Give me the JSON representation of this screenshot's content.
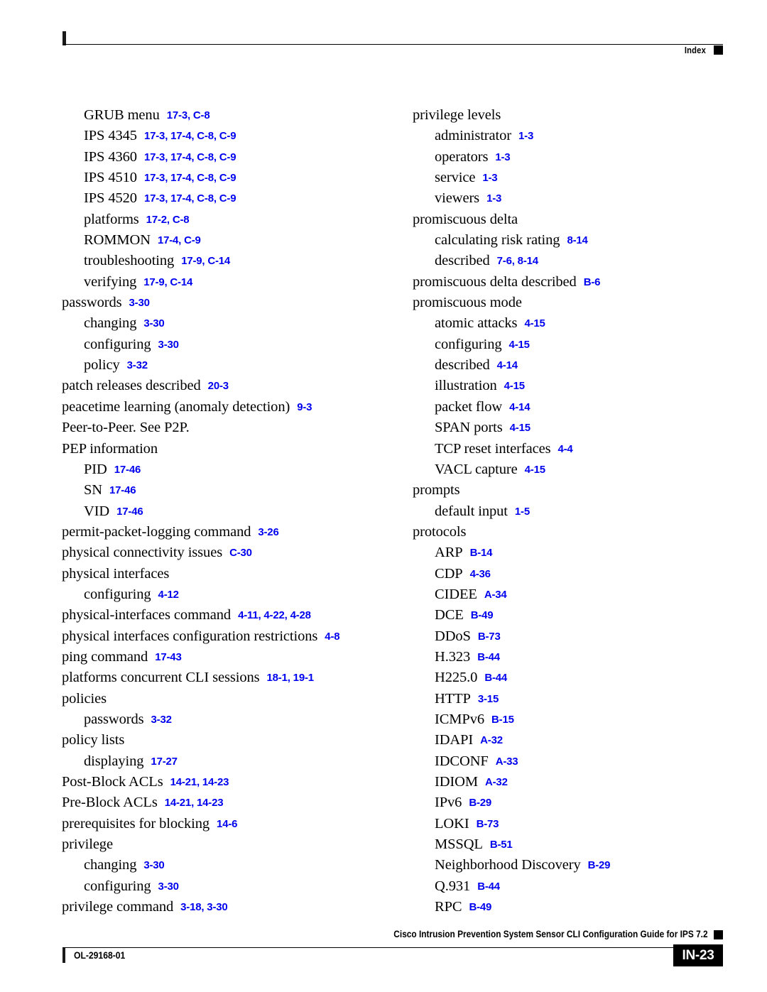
{
  "header": {
    "label": "Index",
    "marker_icon": "black-square-icon"
  },
  "footer": {
    "guide_title": "Cisco Intrusion Prevention System Sensor CLI Configuration Guide for IPS 7.2",
    "doc_id": "OL-29168-01",
    "page_number": "IN-23",
    "marker_icon": "black-square-icon"
  },
  "index": {
    "columns": [
      {
        "name": "left-column",
        "entries": [
          {
            "level": 1,
            "term": "GRUB menu",
            "locators": "17-3, C-8"
          },
          {
            "level": 1,
            "term": "IPS 4345",
            "locators": "17-3, 17-4, C-8, C-9"
          },
          {
            "level": 1,
            "term": "IPS 4360",
            "locators": "17-3, 17-4, C-8, C-9"
          },
          {
            "level": 1,
            "term": "IPS 4510",
            "locators": "17-3, 17-4, C-8, C-9"
          },
          {
            "level": 1,
            "term": "IPS 4520",
            "locators": "17-3, 17-4, C-8, C-9"
          },
          {
            "level": 1,
            "term": "platforms",
            "locators": "17-2, C-8"
          },
          {
            "level": 1,
            "term": "ROMMON",
            "locators": "17-4, C-9"
          },
          {
            "level": 1,
            "term": "troubleshooting",
            "locators": "17-9, C-14"
          },
          {
            "level": 1,
            "term": "verifying",
            "locators": "17-9, C-14"
          },
          {
            "level": 0,
            "term": "passwords",
            "locators": "3-30"
          },
          {
            "level": 1,
            "term": "changing",
            "locators": "3-30"
          },
          {
            "level": 1,
            "term": "configuring",
            "locators": "3-30"
          },
          {
            "level": 1,
            "term": "policy",
            "locators": "3-32"
          },
          {
            "level": 0,
            "term": "patch releases described",
            "locators": "20-3"
          },
          {
            "level": 0,
            "term": "peacetime learning (anomaly detection)",
            "locators": "9-3"
          },
          {
            "level": 0,
            "term": "Peer-to-Peer. See P2P.",
            "locators": ""
          },
          {
            "level": 0,
            "term": "PEP information",
            "locators": ""
          },
          {
            "level": 1,
            "term": "PID",
            "locators": "17-46"
          },
          {
            "level": 1,
            "term": "SN",
            "locators": "17-46"
          },
          {
            "level": 1,
            "term": "VID",
            "locators": "17-46"
          },
          {
            "level": 0,
            "term": "permit-packet-logging command",
            "locators": "3-26"
          },
          {
            "level": 0,
            "term": "physical connectivity issues",
            "locators": "C-30"
          },
          {
            "level": 0,
            "term": "physical interfaces",
            "locators": ""
          },
          {
            "level": 1,
            "term": "configuring",
            "locators": "4-12"
          },
          {
            "level": 0,
            "term": "physical-interfaces command",
            "locators": "4-11, 4-22, 4-28"
          },
          {
            "level": 0,
            "term": "physical interfaces configuration restrictions",
            "locators": "4-8"
          },
          {
            "level": 0,
            "term": "ping command",
            "locators": "17-43"
          },
          {
            "level": 0,
            "term": "platforms concurrent CLI sessions",
            "locators": "18-1, 19-1"
          },
          {
            "level": 0,
            "term": "policies",
            "locators": ""
          },
          {
            "level": 1,
            "term": "passwords",
            "locators": "3-32"
          },
          {
            "level": 0,
            "term": "policy lists",
            "locators": ""
          },
          {
            "level": 1,
            "term": "displaying",
            "locators": "17-27"
          },
          {
            "level": 0,
            "term": "Post-Block ACLs",
            "locators": "14-21, 14-23"
          },
          {
            "level": 0,
            "term": "Pre-Block ACLs",
            "locators": "14-21, 14-23"
          },
          {
            "level": 0,
            "term": "prerequisites for blocking",
            "locators": "14-6"
          },
          {
            "level": 0,
            "term": "privilege",
            "locators": ""
          },
          {
            "level": 1,
            "term": "changing",
            "locators": "3-30"
          },
          {
            "level": 1,
            "term": "configuring",
            "locators": "3-30"
          },
          {
            "level": 0,
            "term": "privilege command",
            "locators": "3-18, 3-30"
          }
        ]
      },
      {
        "name": "right-column",
        "entries": [
          {
            "level": 0,
            "term": "privilege levels",
            "locators": ""
          },
          {
            "level": 1,
            "term": "administrator",
            "locators": "1-3"
          },
          {
            "level": 1,
            "term": "operators",
            "locators": "1-3"
          },
          {
            "level": 1,
            "term": "service",
            "locators": "1-3"
          },
          {
            "level": 1,
            "term": "viewers",
            "locators": "1-3"
          },
          {
            "level": 0,
            "term": "promiscuous delta",
            "locators": ""
          },
          {
            "level": 1,
            "term": "calculating risk rating",
            "locators": "8-14"
          },
          {
            "level": 1,
            "term": "described",
            "locators": "7-6, 8-14"
          },
          {
            "level": 0,
            "term": "promiscuous delta described",
            "locators": "B-6"
          },
          {
            "level": 0,
            "term": "promiscuous mode",
            "locators": ""
          },
          {
            "level": 1,
            "term": "atomic attacks",
            "locators": "4-15"
          },
          {
            "level": 1,
            "term": "configuring",
            "locators": "4-15"
          },
          {
            "level": 1,
            "term": "described",
            "locators": "4-14"
          },
          {
            "level": 1,
            "term": "illustration",
            "locators": "4-15"
          },
          {
            "level": 1,
            "term": "packet flow",
            "locators": "4-14"
          },
          {
            "level": 1,
            "term": "SPAN ports",
            "locators": "4-15"
          },
          {
            "level": 1,
            "term": "TCP reset interfaces",
            "locators": "4-4"
          },
          {
            "level": 1,
            "term": "VACL capture",
            "locators": "4-15"
          },
          {
            "level": 0,
            "term": "prompts",
            "locators": ""
          },
          {
            "level": 1,
            "term": "default input",
            "locators": "1-5"
          },
          {
            "level": 0,
            "term": "protocols",
            "locators": ""
          },
          {
            "level": 1,
            "term": "ARP",
            "locators": "B-14"
          },
          {
            "level": 1,
            "term": "CDP",
            "locators": "4-36"
          },
          {
            "level": 1,
            "term": "CIDEE",
            "locators": "A-34"
          },
          {
            "level": 1,
            "term": "DCE",
            "locators": "B-49"
          },
          {
            "level": 1,
            "term": "DDoS",
            "locators": "B-73"
          },
          {
            "level": 1,
            "term": "H.323",
            "locators": "B-44"
          },
          {
            "level": 1,
            "term": "H225.0",
            "locators": "B-44"
          },
          {
            "level": 1,
            "term": "HTTP",
            "locators": "3-15"
          },
          {
            "level": 1,
            "term": "ICMPv6",
            "locators": "B-15"
          },
          {
            "level": 1,
            "term": "IDAPI",
            "locators": "A-32"
          },
          {
            "level": 1,
            "term": "IDCONF",
            "locators": "A-33"
          },
          {
            "level": 1,
            "term": "IDIOM",
            "locators": "A-32"
          },
          {
            "level": 1,
            "term": "IPv6",
            "locators": "B-29"
          },
          {
            "level": 1,
            "term": "LOKI",
            "locators": "B-73"
          },
          {
            "level": 1,
            "term": "MSSQL",
            "locators": "B-51"
          },
          {
            "level": 1,
            "term": "Neighborhood Discovery",
            "locators": "B-29"
          },
          {
            "level": 1,
            "term": "Q.931",
            "locators": "B-44"
          },
          {
            "level": 1,
            "term": "RPC",
            "locators": "B-49"
          }
        ]
      }
    ]
  },
  "colors": {
    "locator_blue": "#0000f0",
    "text_black": "#000000",
    "page_box_bg": "#000000"
  }
}
